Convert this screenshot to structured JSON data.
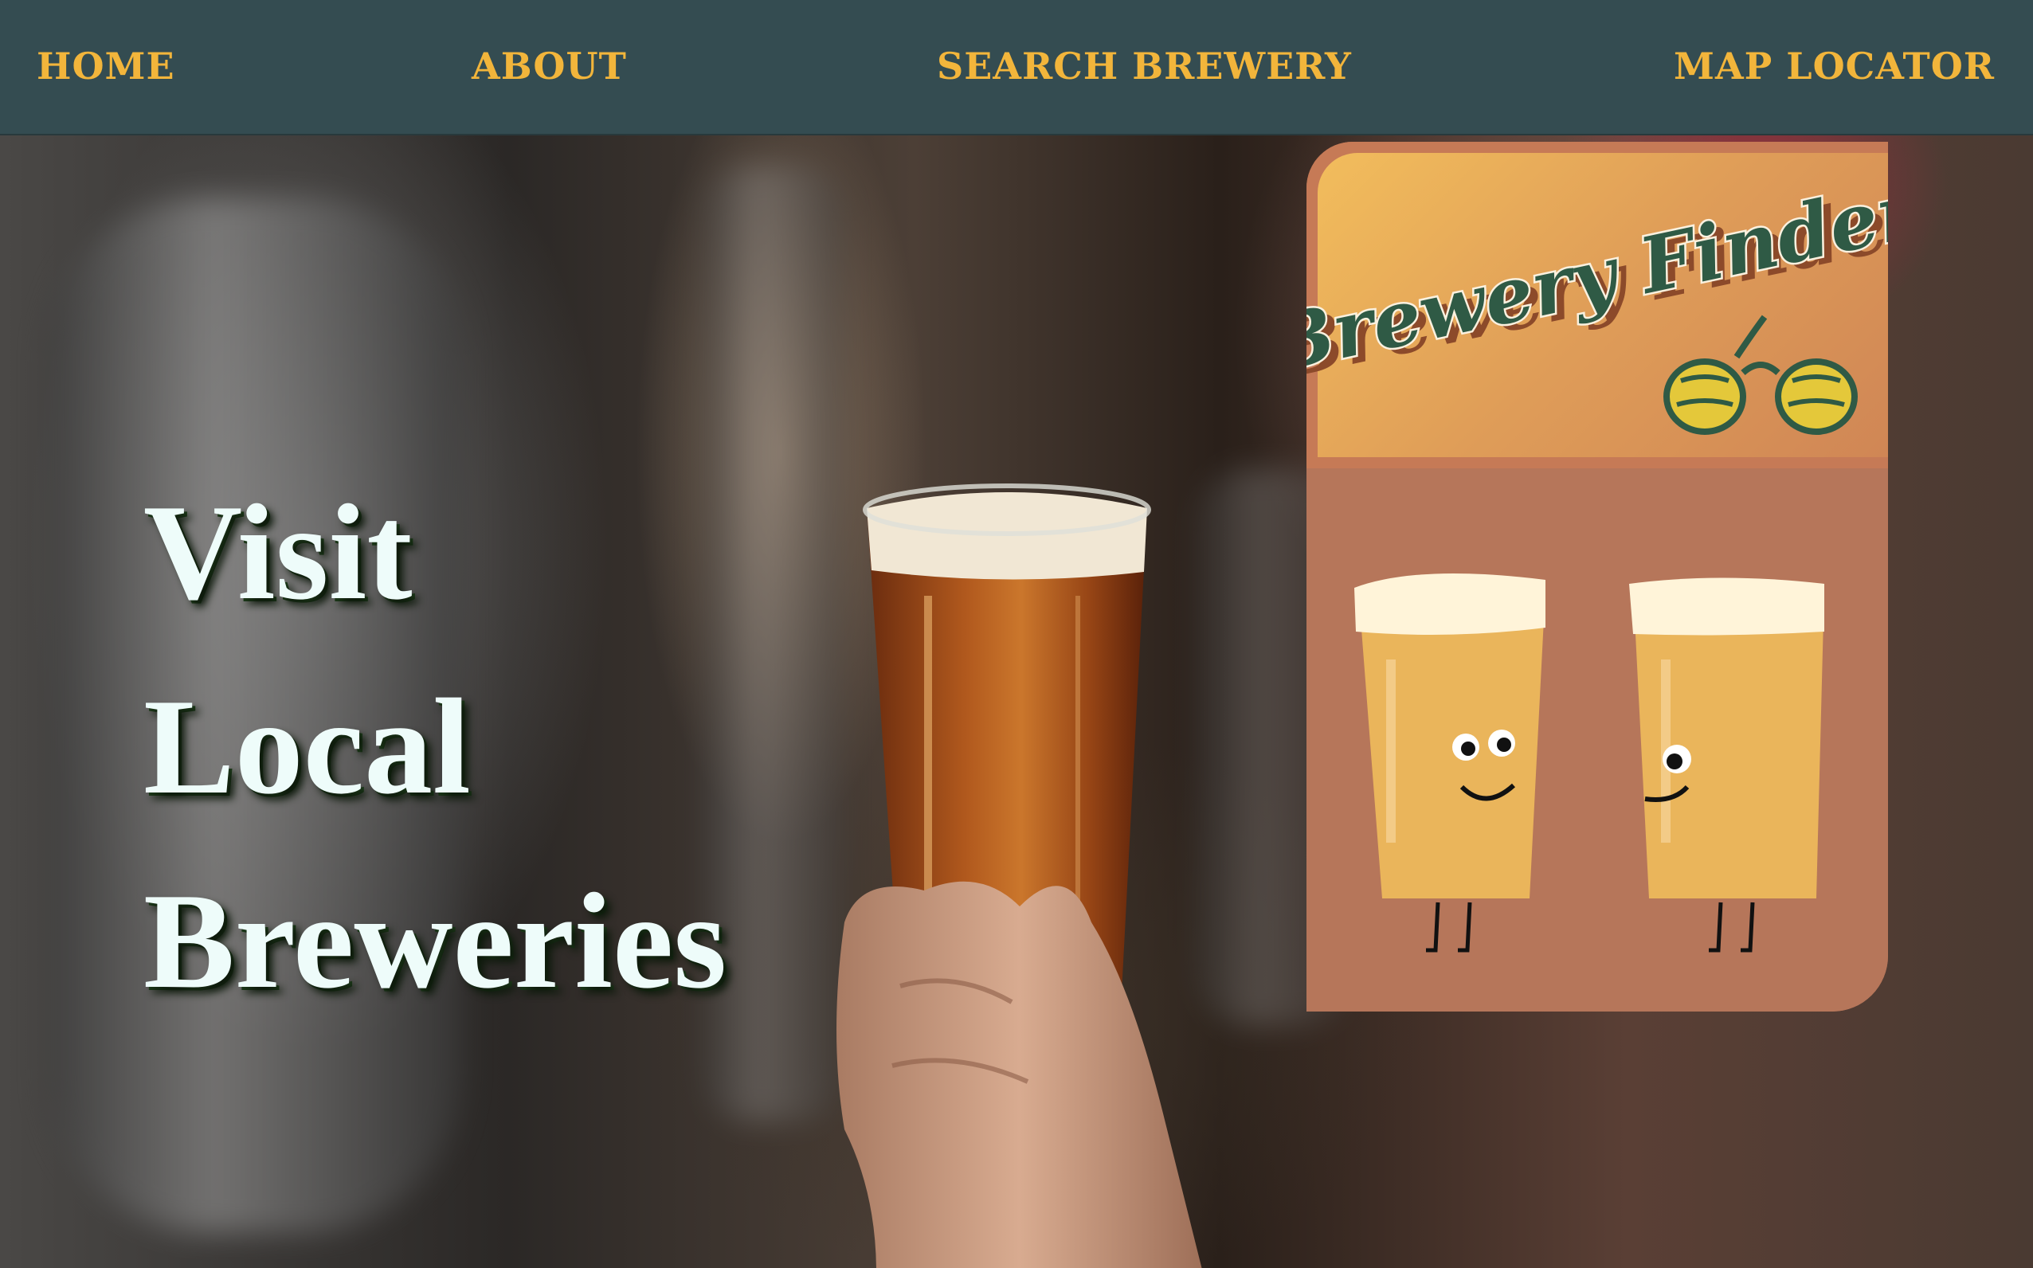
{
  "nav": {
    "items": [
      {
        "label": "HOME"
      },
      {
        "label": "ABOUT"
      },
      {
        "label": "SEARCH BREWERY"
      },
      {
        "label": "MAP LOCATOR"
      }
    ]
  },
  "hero": {
    "headline": [
      "Visit",
      "Local",
      "Breweries"
    ]
  },
  "finder_card": {
    "logo_text": "Brewery Finder"
  },
  "colors": {
    "nav_background": "#344c51",
    "nav_text": "#f2b53b",
    "headline_text": "#eefcfa",
    "logo_green": "#2f5a45",
    "card_brown": "#b6765a",
    "card_orange": "#f2bd5c"
  }
}
